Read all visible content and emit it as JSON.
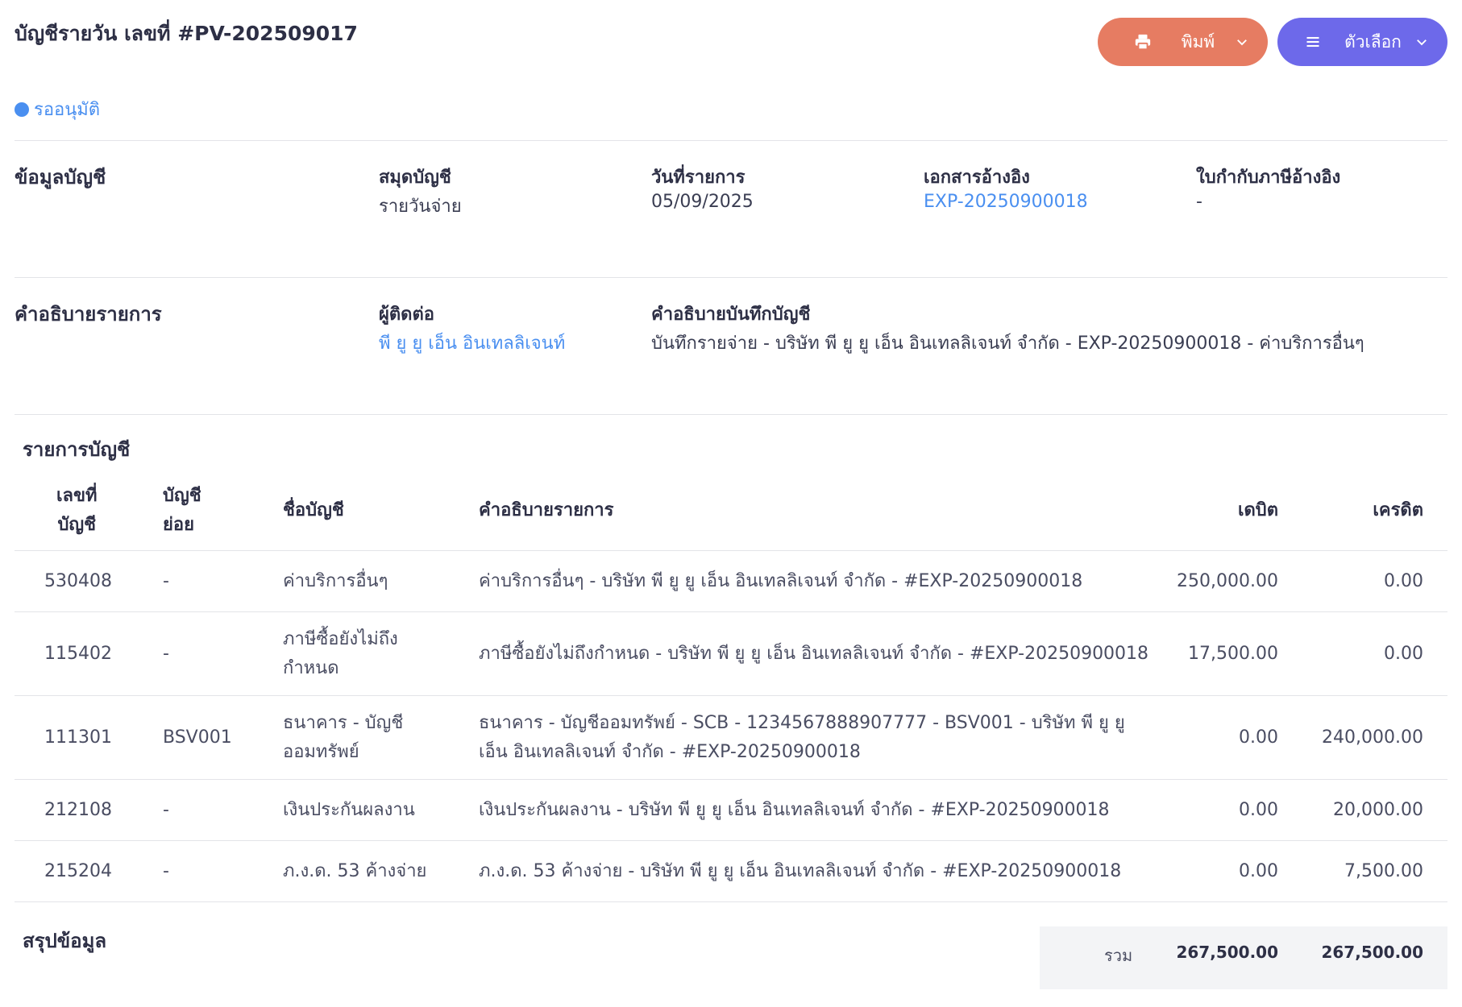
{
  "header": {
    "title": "บัญชีรายวัน เลขที่ #PV-202509017",
    "print_label": "พิมพ์",
    "options_label": "ตัวเลือก"
  },
  "status": {
    "label": "รออนุมัติ",
    "color": "#4a8ff0"
  },
  "account_info": {
    "section": "ข้อมูลบัญชี",
    "book_label": "สมุดบัญชี",
    "book_value": "รายวันจ่าย",
    "date_label": "วันที่รายการ",
    "date_value": "05/09/2025",
    "ref_doc_label": "เอกสารอ้างอิง",
    "ref_doc_value": "EXP-20250900018",
    "tax_ref_label": "ใบกำกับภาษีอ้างอิง",
    "tax_ref_value": "-"
  },
  "description": {
    "section": "คำอธิบายรายการ",
    "contact_label": "ผู้ติดต่อ",
    "contact_value": "พี ยู ยู เอ็น อินเทลลิเจนท์",
    "note_label": "คำอธิบายบันทึกบัญชี",
    "note_value": "บันทึกรายจ่าย - บริษัท พี ยู ยู เอ็น อินเทลลิเจนท์ จำกัด - EXP-20250900018 - ค่าบริการอื่นๆ"
  },
  "entries": {
    "section": "รายการบัญชี",
    "headers": {
      "account_no_1": "เลขที่",
      "account_no_2": "บัญชี",
      "sub_1": "บัญชี",
      "sub_2": "ย่อย",
      "name": "ชื่อบัญชี",
      "desc": "คำอธิบายรายการ",
      "debit": "เดบิต",
      "credit": "เครดิต"
    },
    "rows": [
      {
        "no": "530408",
        "sub": "-",
        "name1": "ค่าบริการอื่นๆ",
        "name2": "",
        "desc1": "ค่าบริการอื่นๆ - บริษัท พี ยู ยู เอ็น อินเทลลิเจนท์ จำกัด - #EXP-20250900018",
        "desc2": "",
        "debit": "250,000.00",
        "credit": "0.00"
      },
      {
        "no": "115402",
        "sub": "-",
        "name1": "ภาษีซื้อยังไม่ถึง",
        "name2": "กำหนด",
        "desc1": "ภาษีซื้อยังไม่ถึงกำหนด - บริษัท พี ยู ยู เอ็น อินเทลลิเจนท์ จำกัด - #EXP-20250900018",
        "desc2": "",
        "debit": "17,500.00",
        "credit": "0.00"
      },
      {
        "no": "111301",
        "sub": "BSV001",
        "name1": "ธนาคาร - บัญชี",
        "name2": "ออมทรัพย์",
        "desc1": "ธนาคาร - บัญชีออมทรัพย์ - SCB - 1234567888907777 - BSV001 - บริษัท พี ยู ยู",
        "desc2": "เอ็น อินเทลลิเจนท์ จำกัด - #EXP-20250900018",
        "debit": "0.00",
        "credit": "240,000.00"
      },
      {
        "no": "212108",
        "sub": "-",
        "name1": "เงินประกันผลงาน",
        "name2": "",
        "desc1": "เงินประกันผลงาน - บริษัท พี ยู ยู เอ็น อินเทลลิเจนท์ จำกัด - #EXP-20250900018",
        "desc2": "",
        "debit": "0.00",
        "credit": "20,000.00"
      },
      {
        "no": "215204",
        "sub": "-",
        "name1": "ภ.ง.ด. 53 ค้างจ่าย",
        "name2": "",
        "desc1": "ภ.ง.ด. 53 ค้างจ่าย - บริษัท พี ยู ยู เอ็น อินเทลลิเจนท์ จำกัด - #EXP-20250900018",
        "desc2": "",
        "debit": "0.00",
        "credit": "7,500.00"
      }
    ]
  },
  "summary": {
    "section": "สรุปข้อมูล",
    "total_label": "รวม",
    "total_debit": "267,500.00",
    "total_credit": "267,500.00"
  }
}
